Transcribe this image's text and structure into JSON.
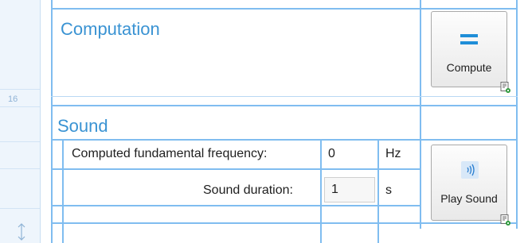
{
  "gutter": {
    "row_number": "16"
  },
  "computation": {
    "title": "Computation",
    "compute_button": {
      "label": "Compute"
    }
  },
  "sound": {
    "title": "Sound",
    "rows": [
      {
        "label": "Computed fundamental frequency:",
        "value": "0",
        "unit": "Hz"
      },
      {
        "label": "Sound duration:",
        "value": "1",
        "unit": "s"
      }
    ],
    "play_button": {
      "label": "Play Sound"
    }
  },
  "icons": {
    "compute": "equals-icon",
    "play": "sound-waves-icon",
    "badge": "document-eye-icon",
    "resize": "vertical-resize-icon"
  },
  "colors": {
    "accent": "#3a93d3",
    "grid": "#80bdf0",
    "gutter": "#eef5fc"
  }
}
